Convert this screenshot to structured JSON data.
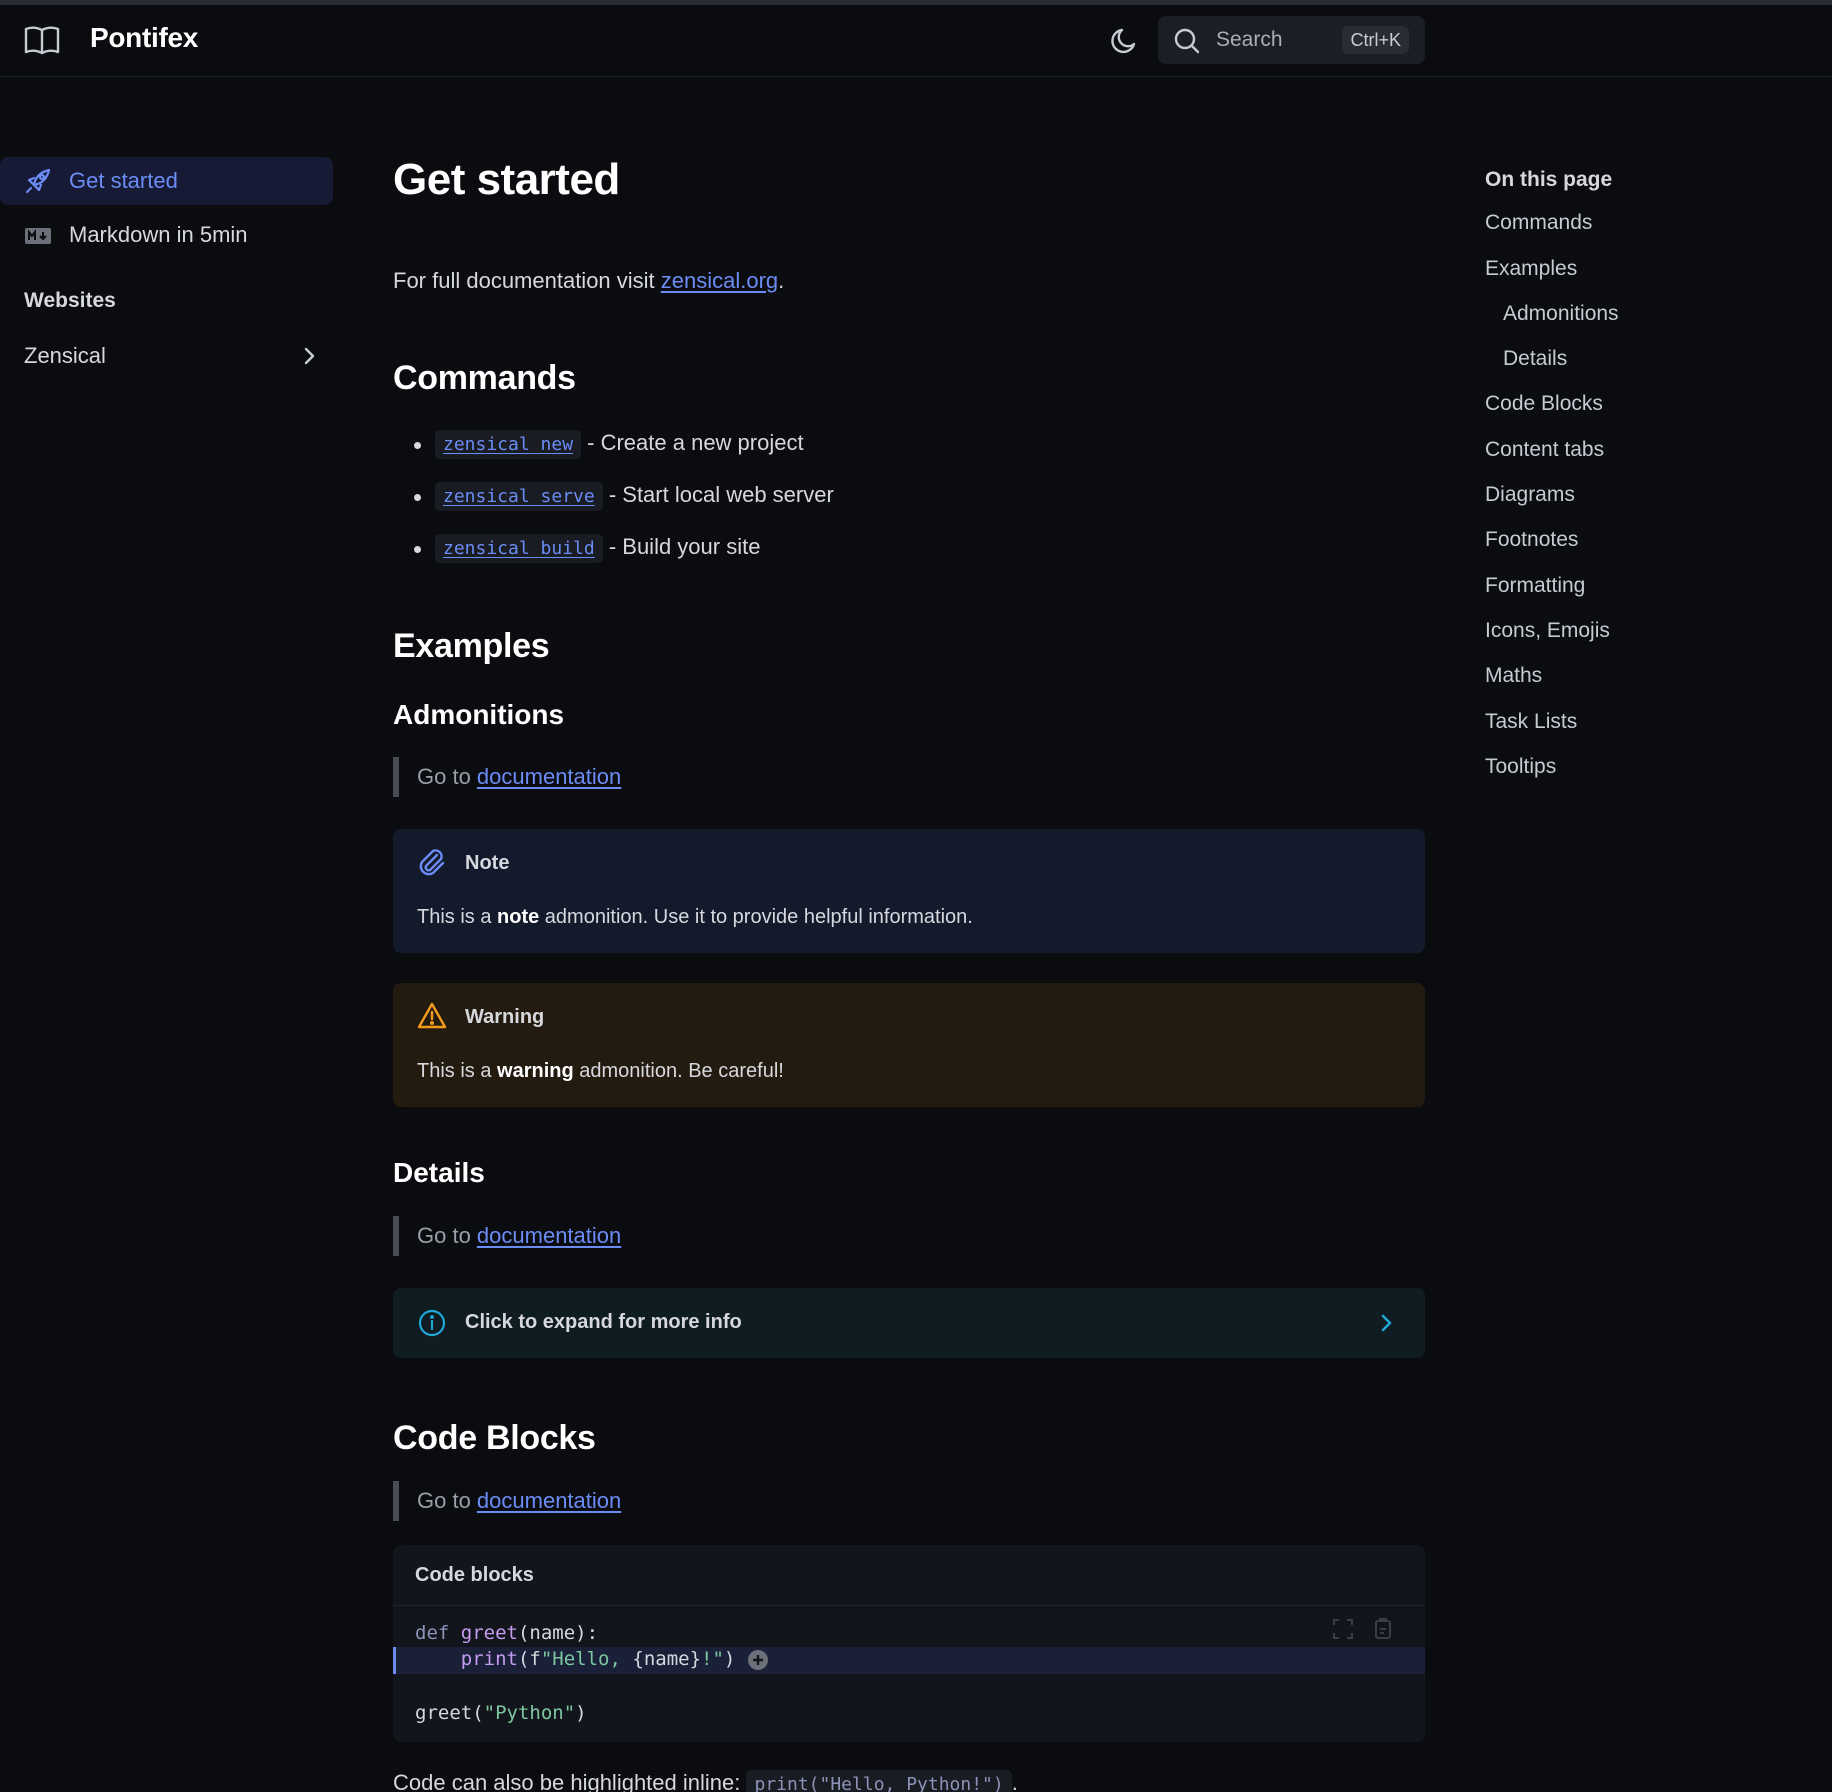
{
  "header": {
    "brand": "Pontifex",
    "search_label": "Search",
    "search_shortcut": "Ctrl+K"
  },
  "sidebar": {
    "items": [
      {
        "label": "Get started",
        "icon": "rocket-icon",
        "active": true
      },
      {
        "label": "Markdown in 5min",
        "icon": "markdown-icon",
        "active": false
      }
    ],
    "section_title": "Websites",
    "section_items": [
      {
        "label": "Zensical",
        "icon": "chevron-right-icon"
      }
    ]
  },
  "main": {
    "title": "Get started",
    "intro_prefix": "For full documentation visit ",
    "intro_link": "zensical.org",
    "intro_suffix": ".",
    "commands_heading": "Commands",
    "commands": [
      {
        "code": "zensical new",
        "desc": " - Create a new project"
      },
      {
        "code": "zensical serve",
        "desc": " - Start local web server"
      },
      {
        "code": "zensical build",
        "desc": " - Build your site"
      }
    ],
    "examples_heading": "Examples",
    "admonitions_heading": "Admonitions",
    "goto_prefix": "Go to ",
    "goto_link": "documentation",
    "note": {
      "title": "Note",
      "body_prefix": "This is a ",
      "body_bold": "note",
      "body_suffix": " admonition. Use it to provide helpful information.",
      "color": "#6c8cf5"
    },
    "warning": {
      "title": "Warning",
      "body_prefix": "This is a ",
      "body_bold": "warning",
      "body_suffix": " admonition. Be careful!",
      "color": "#f59b1b"
    },
    "details_heading": "Details",
    "details_summary": "Click to expand for more info",
    "code_blocks_heading": "Code Blocks",
    "codeblock_title": "Code blocks",
    "code_lines": [
      "def greet(name):",
      "    print(f\"Hello, {name}!\")",
      "greet(\"Python\")"
    ],
    "inline_prefix": "Code can also be highlighted inline: ",
    "inline_code": "print(\"Hello, Python!\")",
    "inline_suffix": "."
  },
  "toc": {
    "title": "On this page",
    "items": [
      {
        "label": "Commands",
        "level": 1
      },
      {
        "label": "Examples",
        "level": 1
      },
      {
        "label": "Admonitions",
        "level": 2
      },
      {
        "label": "Details",
        "level": 2
      },
      {
        "label": "Code Blocks",
        "level": 1
      },
      {
        "label": "Content tabs",
        "level": 1
      },
      {
        "label": "Diagrams",
        "level": 1
      },
      {
        "label": "Footnotes",
        "level": 1
      },
      {
        "label": "Formatting",
        "level": 1
      },
      {
        "label": "Icons, Emojis",
        "level": 1
      },
      {
        "label": "Maths",
        "level": 1
      },
      {
        "label": "Task Lists",
        "level": 1
      },
      {
        "label": "Tooltips",
        "level": 1
      }
    ]
  },
  "colors": {
    "accent": "#6c8cf5",
    "background": "#0b0c10",
    "details_accent": "#1fa7d6"
  }
}
